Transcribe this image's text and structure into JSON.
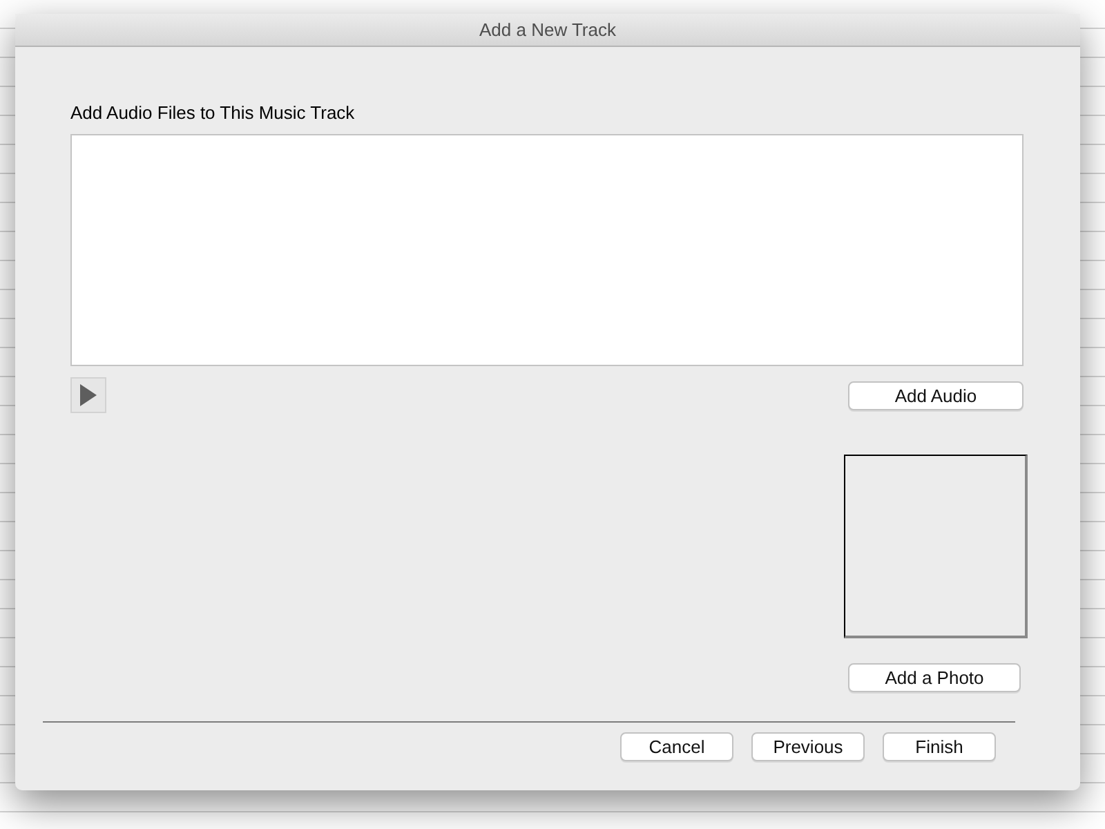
{
  "window": {
    "title": "Add a New Track"
  },
  "audio_section": {
    "label": "Add Audio Files to This Music Track",
    "add_button": "Add Audio"
  },
  "photo_section": {
    "add_button": "Add a Photo"
  },
  "buttons": [
    "Cancel",
    "Previous",
    "Finish"
  ]
}
